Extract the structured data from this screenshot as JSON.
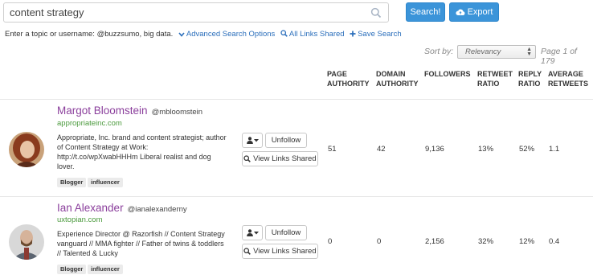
{
  "search": {
    "value": "content strategy",
    "button": "Search!",
    "export": "Export"
  },
  "hint": {
    "text": "Enter a topic or username: @buzzsumo, big data.",
    "advanced": "Advanced Search Options",
    "all_links": "All Links Shared",
    "save": "Save Search"
  },
  "sort": {
    "label": "Sort by:",
    "value": "Relevancy",
    "page": "Page 1 of 179"
  },
  "columns": {
    "page_authority": [
      "PAGE",
      "AUTHORITY"
    ],
    "domain_authority": [
      "DOMAIN",
      "AUTHORITY"
    ],
    "followers": [
      "FOLLOWERS"
    ],
    "retweet_ratio": [
      "RETWEET",
      "RATIO"
    ],
    "reply_ratio": [
      "REPLY",
      "RATIO"
    ],
    "avg_retweets": [
      "AVERAGE",
      "RETWEETS"
    ]
  },
  "actions": {
    "unfollow": "Unfollow",
    "view_links": "View Links Shared"
  },
  "influencers": [
    {
      "name": "Margot Bloomstein",
      "handle": "@mbloomstein",
      "site": "appropriateinc.com",
      "bio": "Appropriate, Inc. brand and content strategist; author of Content Strategy at Work: http://t.co/wpXwabHHHm Liberal realist and dog lover.",
      "tags": [
        "Blogger",
        "influencer"
      ],
      "page_authority": "51",
      "domain_authority": "42",
      "followers": "9,136",
      "retweet_ratio": "13%",
      "reply_ratio": "52%",
      "avg_retweets": "1.1"
    },
    {
      "name": "Ian Alexander",
      "handle": "@ianalexanderny",
      "site": "uxtopian.com",
      "bio": "Experience Director @ Razorfish // Content Strategy vanguard // MMA fighter // Father of twins & toddlers // Talented & Lucky",
      "tags": [
        "Blogger",
        "influencer"
      ],
      "page_authority": "0",
      "domain_authority": "0",
      "followers": "2,156",
      "retweet_ratio": "32%",
      "reply_ratio": "12%",
      "avg_retweets": "0.4"
    }
  ],
  "colors": {
    "accent": "#3b94d9",
    "name": "#8b3f9c",
    "site": "#4b9a3d",
    "link": "#2a6ebb"
  },
  "icons": [
    "search-icon",
    "cloud-upload-icon",
    "chevron-down-icon",
    "search-icon-small",
    "plus-icon",
    "user-icon",
    "caret-down-icon"
  ]
}
